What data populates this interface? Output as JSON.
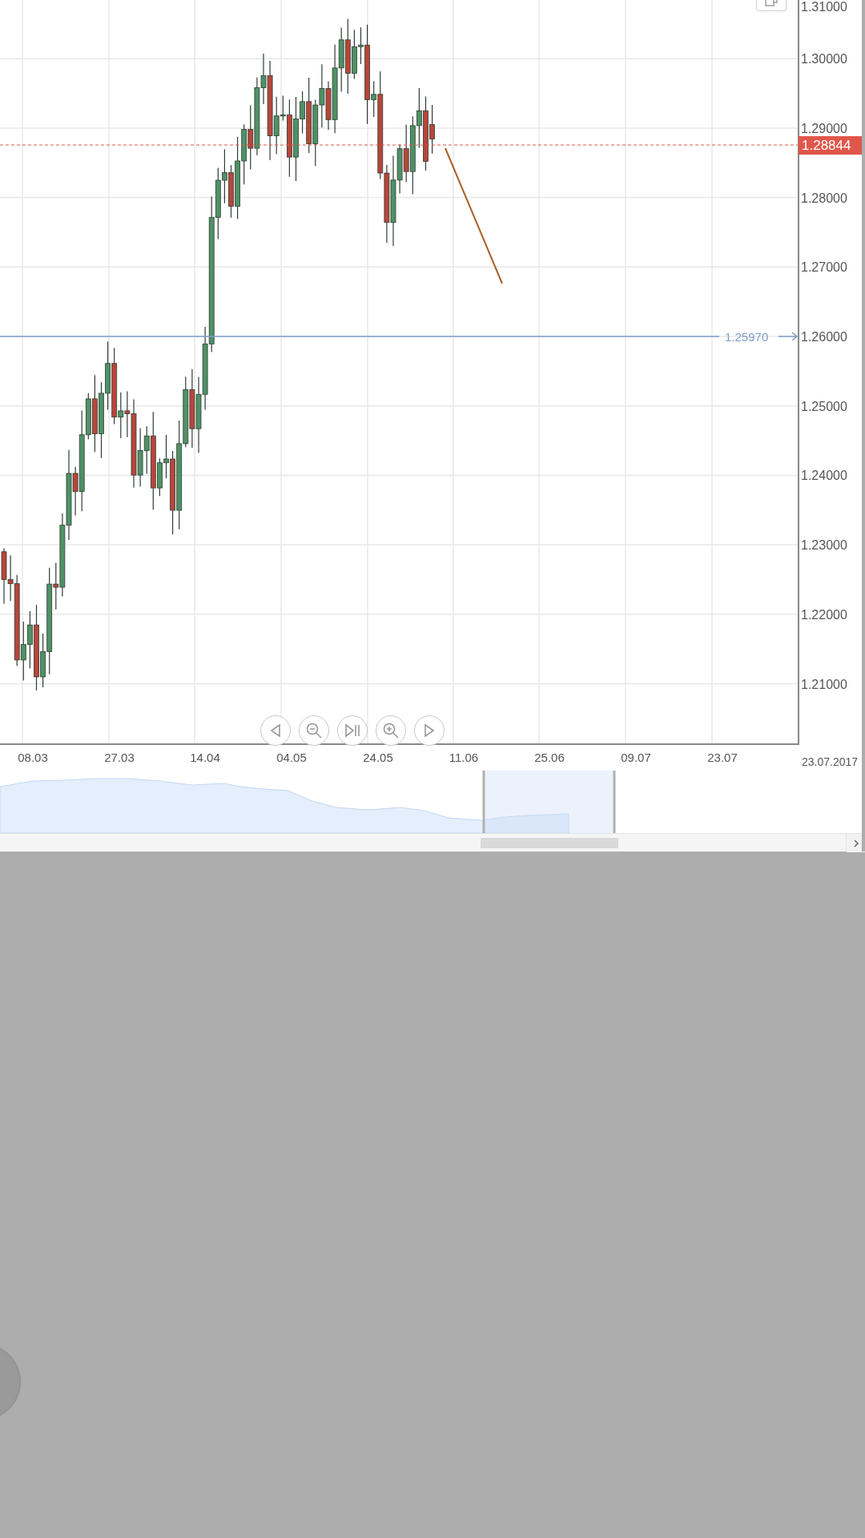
{
  "y_axis": {
    "labels": [
      "1.31000",
      "1.30000",
      "1.29000",
      "1.28000",
      "1.27000",
      "1.26000",
      "1.25000",
      "1.24000",
      "1.23000",
      "1.22000",
      "1.21000"
    ]
  },
  "x_axis": {
    "labels": [
      "08.03",
      "27.03",
      "14.04",
      "04.05",
      "24.05",
      "11.06",
      "25.06",
      "09.07",
      "23.07"
    ],
    "end_date": "23.07.2017"
  },
  "current_price": {
    "label": "1.28844"
  },
  "horizontal_line": {
    "label": "1.25970"
  },
  "navigation_buttons": [
    {
      "kind": "back"
    },
    {
      "kind": "zoom_out"
    },
    {
      "kind": "reset"
    },
    {
      "kind": "zoom_in"
    },
    {
      "kind": "forward"
    }
  ]
}
